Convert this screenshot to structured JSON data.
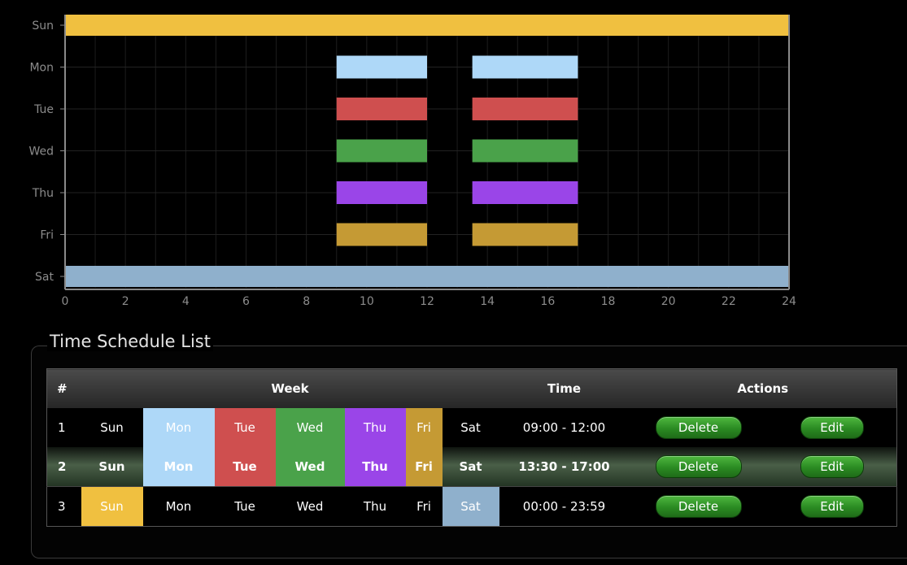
{
  "chart_data": {
    "type": "bar",
    "orientation": "horizontal-timeline",
    "categories": [
      "Sun",
      "Mon",
      "Tue",
      "Wed",
      "Thu",
      "Fri",
      "Sat"
    ],
    "xlim": [
      0,
      24
    ],
    "xticks": [
      0,
      2,
      4,
      6,
      8,
      10,
      12,
      14,
      16,
      18,
      20,
      22,
      24
    ],
    "grid": true,
    "bars": [
      {
        "day": "Sun",
        "start": 0,
        "end": 24,
        "color": "#f0c040"
      },
      {
        "day": "Mon",
        "start": 9,
        "end": 12,
        "color": "#aed8f8"
      },
      {
        "day": "Mon",
        "start": 13.5,
        "end": 17,
        "color": "#aed8f8"
      },
      {
        "day": "Tue",
        "start": 9,
        "end": 12,
        "color": "#cf4f4f"
      },
      {
        "day": "Tue",
        "start": 13.5,
        "end": 17,
        "color": "#cf4f4f"
      },
      {
        "day": "Wed",
        "start": 9,
        "end": 12,
        "color": "#4aa24a"
      },
      {
        "day": "Wed",
        "start": 13.5,
        "end": 17,
        "color": "#4aa24a"
      },
      {
        "day": "Thu",
        "start": 9,
        "end": 12,
        "color": "#9a45e8"
      },
      {
        "day": "Thu",
        "start": 13.5,
        "end": 17,
        "color": "#9a45e8"
      },
      {
        "day": "Fri",
        "start": 9,
        "end": 12,
        "color": "#c59a34"
      },
      {
        "day": "Fri",
        "start": 13.5,
        "end": 17,
        "color": "#c59a34"
      },
      {
        "day": "Sat",
        "start": 0,
        "end": 24,
        "color": "#8fb0cc"
      }
    ]
  },
  "colors": {
    "Sun": "#f0c040",
    "Mon": "#aed8f8",
    "Tue": "#cf4f4f",
    "Wed": "#4aa24a",
    "Thu": "#9a45e8",
    "Fri": "#c59a34",
    "Sat": "#8fb0cc"
  },
  "schedule": {
    "title": "Time Schedule List",
    "headers": {
      "num": "#",
      "week": "Week",
      "time": "Time",
      "actions": "Actions"
    },
    "delete_label": "Delete",
    "edit_label": "Edit",
    "rows": [
      {
        "num": "1",
        "days": [
          "Sun",
          "Mon",
          "Tue",
          "Wed",
          "Thu",
          "Fri",
          "Sat"
        ],
        "active": [
          false,
          true,
          true,
          true,
          true,
          true,
          false
        ],
        "time": "09:00 - 12:00",
        "selected": false
      },
      {
        "num": "2",
        "days": [
          "Sun",
          "Mon",
          "Tue",
          "Wed",
          "Thu",
          "Fri",
          "Sat"
        ],
        "active": [
          false,
          true,
          true,
          true,
          true,
          true,
          false
        ],
        "time": "13:30 - 17:00",
        "selected": true
      },
      {
        "num": "3",
        "days": [
          "Sun",
          "Mon",
          "Tue",
          "Wed",
          "Thu",
          "Fri",
          "Sat"
        ],
        "active": [
          true,
          false,
          false,
          false,
          false,
          false,
          true
        ],
        "time": "00:00 - 23:59",
        "selected": false
      }
    ]
  }
}
